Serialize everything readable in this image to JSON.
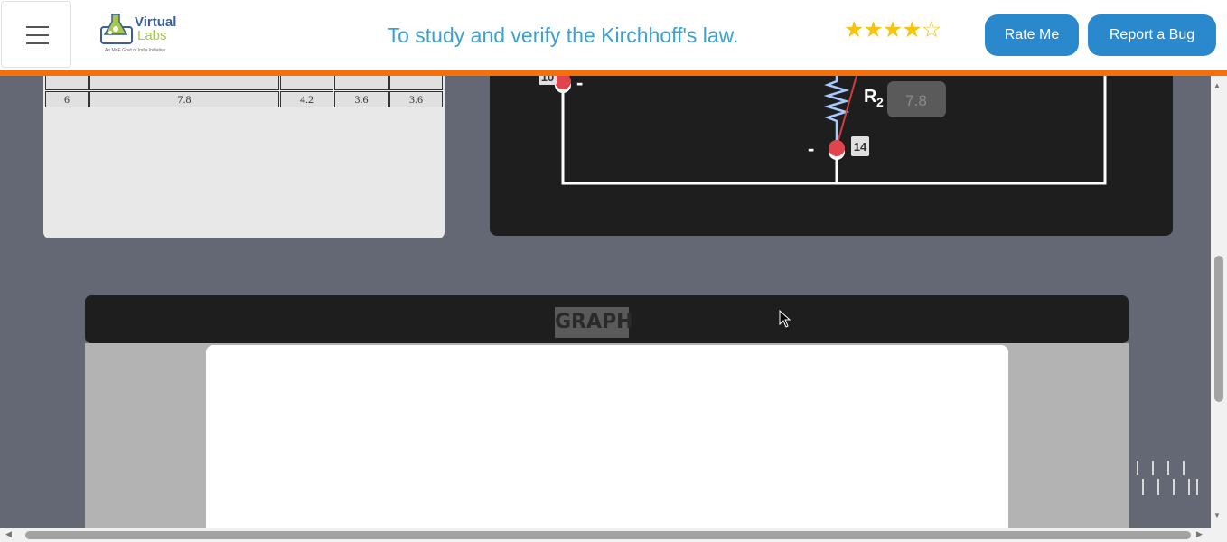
{
  "header": {
    "logo": {
      "name_line1": "Virtual",
      "name_line2": "Labs",
      "tagline": "An MoE Govt of India Initiative"
    },
    "title": "To study and verify the Kirchhoff's law.",
    "rating": {
      "value": 4,
      "max": 5
    },
    "rate_button": "Rate Me",
    "report_button": "Report a Bug"
  },
  "table": {
    "rows": [
      [
        "",
        "",
        "",
        "",
        ""
      ],
      [
        "6",
        "7.8",
        "4.2",
        "3.6",
        "3.6"
      ]
    ]
  },
  "circuit": {
    "node_left": "10",
    "node_right": "14",
    "resistor_label": "R",
    "resistor_subscript": "2",
    "resistor_value": "7.8",
    "sign_left": "-",
    "sign_right": "-",
    "colors": {
      "wire": "#ffffff",
      "probe": "#e0454d",
      "lead": "#d23c3c",
      "coil": "#a8c8ff"
    }
  },
  "graph": {
    "title": "GRAPH"
  },
  "colors": {
    "accent_orange": "#f5700a",
    "button_blue": "#2a88cc",
    "title_blue": "#3aa1d3",
    "star_gold": "#f4c40f"
  }
}
